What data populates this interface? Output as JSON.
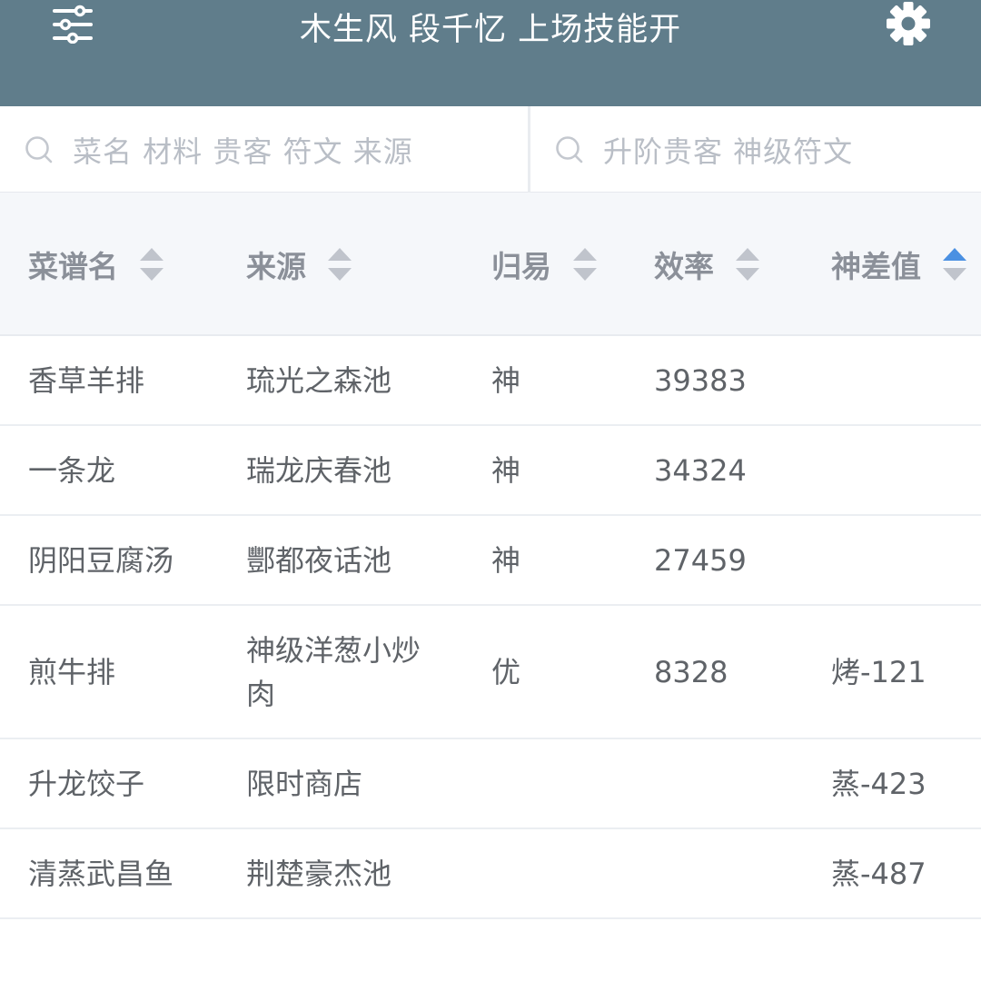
{
  "header": {
    "title": "木生风 段千忆 上场技能开",
    "menu_icon": "sliders-icon",
    "settings_icon": "gear-icon",
    "background": "#607d8b"
  },
  "search": {
    "primary_placeholder": "菜名 材料 贵客 符文 来源",
    "secondary_placeholder": "升阶贵客 神级符文"
  },
  "table": {
    "columns": [
      {
        "label": "菜谱名",
        "sort": "none"
      },
      {
        "label": "来源",
        "sort": "none"
      },
      {
        "label": "归易",
        "sort": "none"
      },
      {
        "label": "效率",
        "sort": "none"
      },
      {
        "label": "神差值",
        "sort": "ascending"
      }
    ],
    "sort_active_color": "#4a90e2",
    "sort_inactive_color": "#c0c4cc",
    "rows": [
      {
        "name": "香草羊排",
        "source": "琉光之森池",
        "rank": "神",
        "efficiency": "39383",
        "diff": ""
      },
      {
        "name": "一条龙",
        "source": "瑞龙庆春池",
        "rank": "神",
        "efficiency": "34324",
        "diff": ""
      },
      {
        "name": "阴阳豆腐汤",
        "source": "酆都夜话池",
        "rank": "神",
        "efficiency": "27459",
        "diff": ""
      },
      {
        "name": "煎牛排",
        "source": "神级洋葱小炒肉",
        "rank": "优",
        "efficiency": "8328",
        "diff": "烤-121"
      },
      {
        "name": "升龙饺子",
        "source": "限时商店",
        "rank": "",
        "efficiency": "",
        "diff": "蒸-423"
      },
      {
        "name": "清蒸武昌鱼",
        "source": "荆楚豪杰池",
        "rank": "",
        "efficiency": "",
        "diff": "蒸-487"
      }
    ]
  }
}
